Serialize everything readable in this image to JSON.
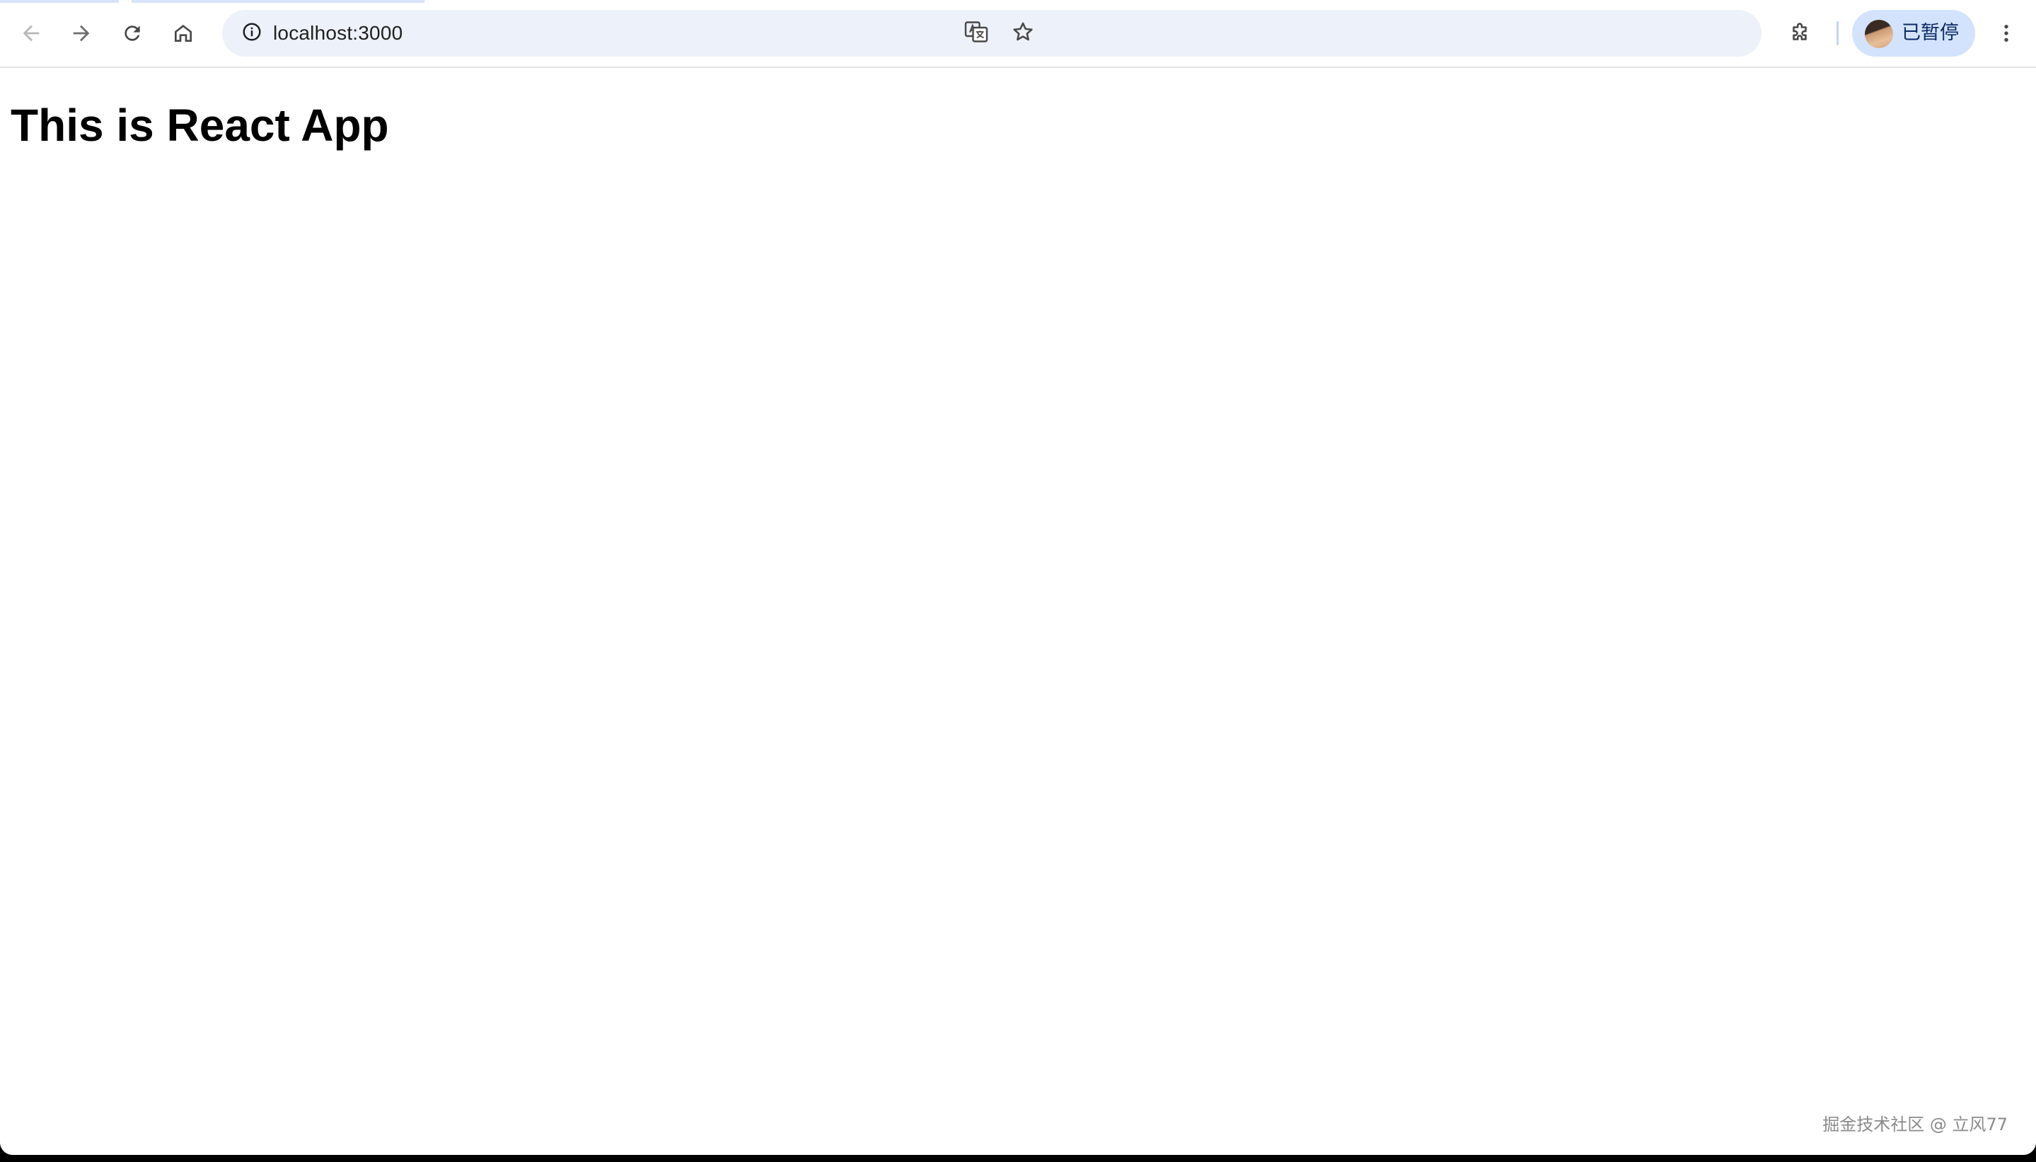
{
  "browser": {
    "url": "localhost:3000",
    "profile_status": "已暂停",
    "nav_icons": {
      "back": "arrow-left-icon",
      "forward": "arrow-right-icon",
      "reload": "reload-icon",
      "home": "home-icon",
      "site_info": "info-icon",
      "translate": "translate-icon",
      "bookmark": "star-icon",
      "extensions": "puzzle-icon",
      "menu": "kebab-menu-icon"
    },
    "colors": {
      "omnibox_bg": "#edf2fa",
      "profile_chip_bg": "#d3e3fd",
      "profile_text": "#0b2a66"
    }
  },
  "page": {
    "heading": "This is React App"
  },
  "watermark": "掘金技术社区 @ 立风77"
}
